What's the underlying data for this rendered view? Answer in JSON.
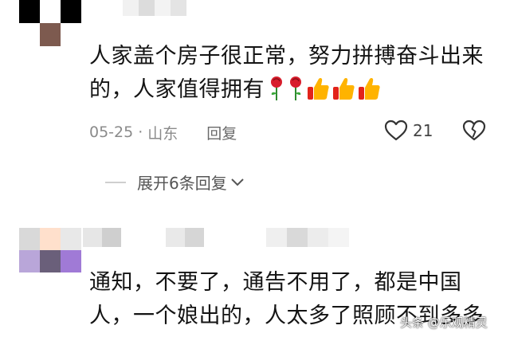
{
  "comments": [
    {
      "text_line1": "人家盖个房子很正常，努力拼搏奋斗出来",
      "text_line2": "的，人家值得拥有",
      "emojis": [
        "rose-icon",
        "rose-icon",
        "thumbs-up-icon",
        "thumbs-up-icon",
        "thumbs-up-icon"
      ],
      "date": "05-25",
      "separator": "·",
      "location": "山东",
      "reply_label": "回复",
      "like_count": "21",
      "expand_label": "展开6条回复"
    },
    {
      "text_line1": "通知，不要了，通告不用了，都是中国",
      "text_line2": "人，一个娘出的，人太多了照顾不到多多"
    }
  ],
  "watermark": "头条 @乐观精灵",
  "colors": {
    "text": "#141414",
    "meta": "#8a8a8a",
    "rose": "#d81e2c",
    "thumb": "#ffb300"
  }
}
